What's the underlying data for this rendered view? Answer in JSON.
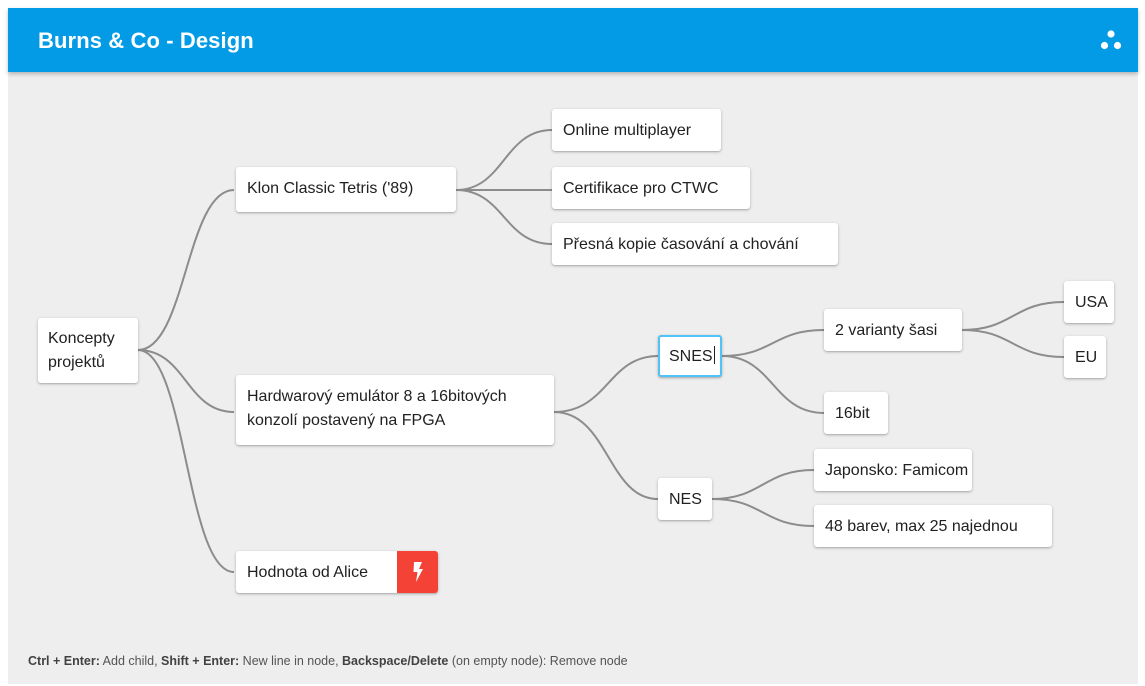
{
  "app": {
    "title": "Burns & Co - Design",
    "accent_color": "#039be5",
    "action_color": "#f44336",
    "menu_icon": "cluster-icon"
  },
  "mindmap": {
    "root": "Koncepty projektů",
    "branch_tetris": "Klon Classic Tetris ('89)",
    "tetris_online": "Online multiplayer",
    "tetris_cert": "Certifikace pro CTWC",
    "tetris_copy": "Přesná kopie časování a chování",
    "branch_hw": "Hardwarový emulátor 8 a 16bitových konzolí postavený na FPGA",
    "snes": "SNES",
    "snes_chassis": "2 varianty šasi",
    "chassis_usa": "USA",
    "chassis_eu": "EU",
    "snes_16bit": "16bit",
    "nes": "NES",
    "nes_japan": "Japonsko: Famicom",
    "nes_colors": "48 barev, max 25 najednou",
    "branch_alice": "Hodnota od Alice",
    "alice_action_icon": "lightning-icon"
  },
  "hint": {
    "k1": "Ctrl + Enter:",
    "t1": " Add child, ",
    "k2": "Shift + Enter:",
    "t2": " New line in node, ",
    "k3": "Backspace/Delete",
    "t3": " (on empty node): Remove node"
  }
}
